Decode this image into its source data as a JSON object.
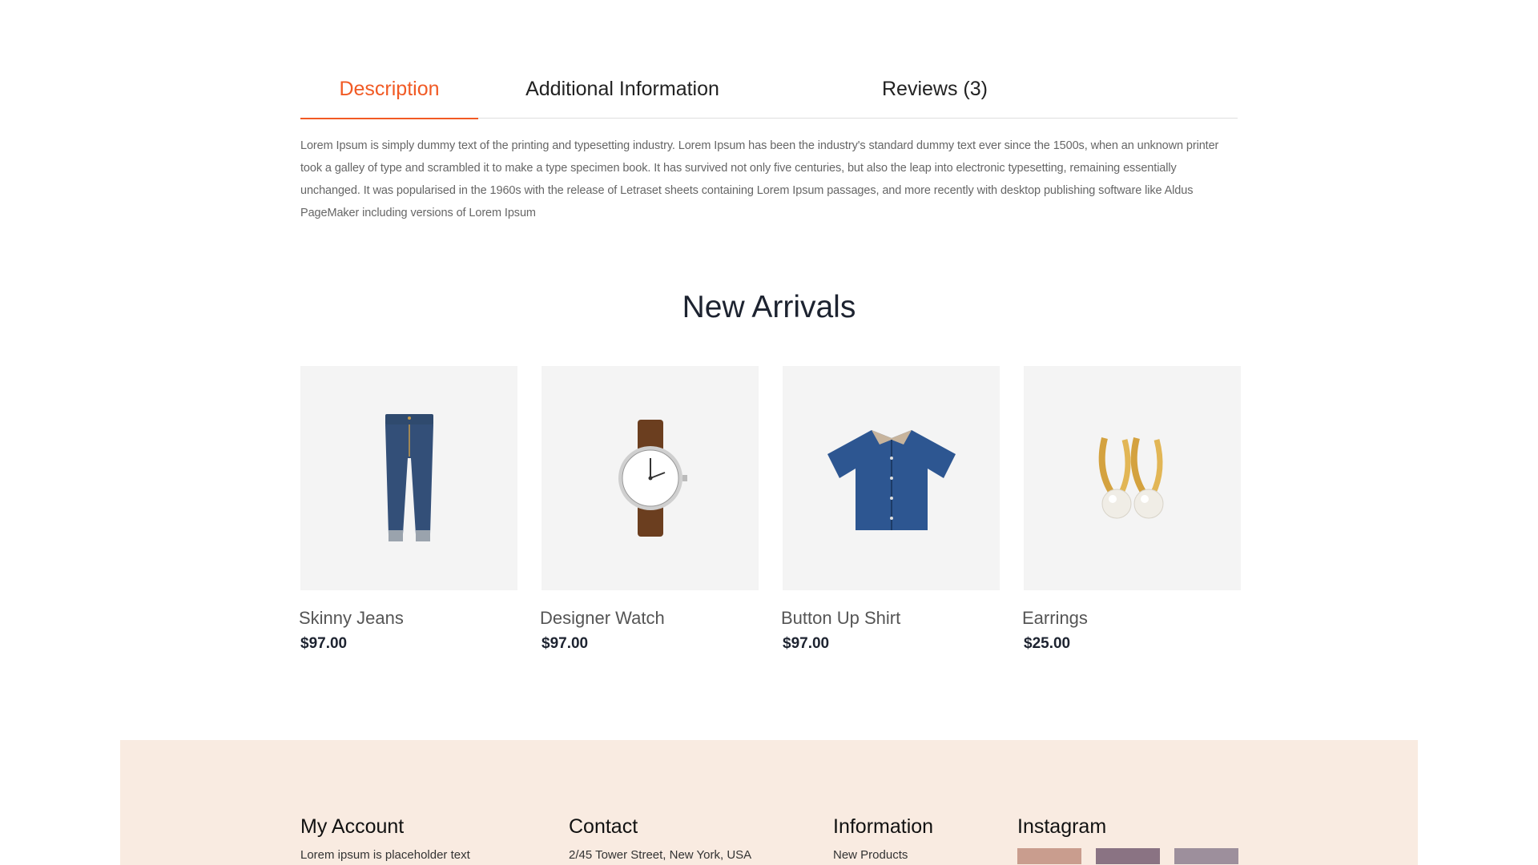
{
  "tabs": [
    {
      "label": "Description",
      "active": true
    },
    {
      "label": "Additional Information",
      "active": false
    },
    {
      "label": "Reviews (3)",
      "active": false
    }
  ],
  "description": "Lorem Ipsum is simply dummy text of the printing and typesetting industry. Lorem Ipsum has been the industry's standard dummy text ever since the 1500s, when an unknown printer took a galley of type and scrambled it to make a type specimen book. It has survived not only five centuries, but also the leap into electronic typesetting, remaining essentially unchanged. It was popularised in the 1960s with the release of Letraset sheets containing Lorem Ipsum passages, and more recently with desktop publishing software like Aldus PageMaker including versions of Lorem Ipsum",
  "new_arrivals": {
    "title": "New Arrivals",
    "products": [
      {
        "name": "Skinny Jeans",
        "price": "$97.00",
        "icon": "jeans-icon"
      },
      {
        "name": "Designer Watch",
        "price": "$97.00",
        "icon": "watch-icon"
      },
      {
        "name": "Button Up Shirt",
        "price": "$97.00",
        "icon": "shirt-icon"
      },
      {
        "name": "Earrings",
        "price": "$25.00",
        "icon": "earrings-icon"
      }
    ]
  },
  "footer": {
    "my_account": {
      "title": "My Account",
      "text": "Lorem ipsum is placeholder text"
    },
    "contact": {
      "title": "Contact",
      "text": "2/45 Tower Street, New York, USA"
    },
    "information": {
      "title": "Information",
      "text": "New Products"
    },
    "instagram": {
      "title": "Instagram"
    }
  },
  "colors": {
    "accent": "#f15a24",
    "footer_bg": "#f9ebe1",
    "card_bg": "#f4f4f4"
  }
}
